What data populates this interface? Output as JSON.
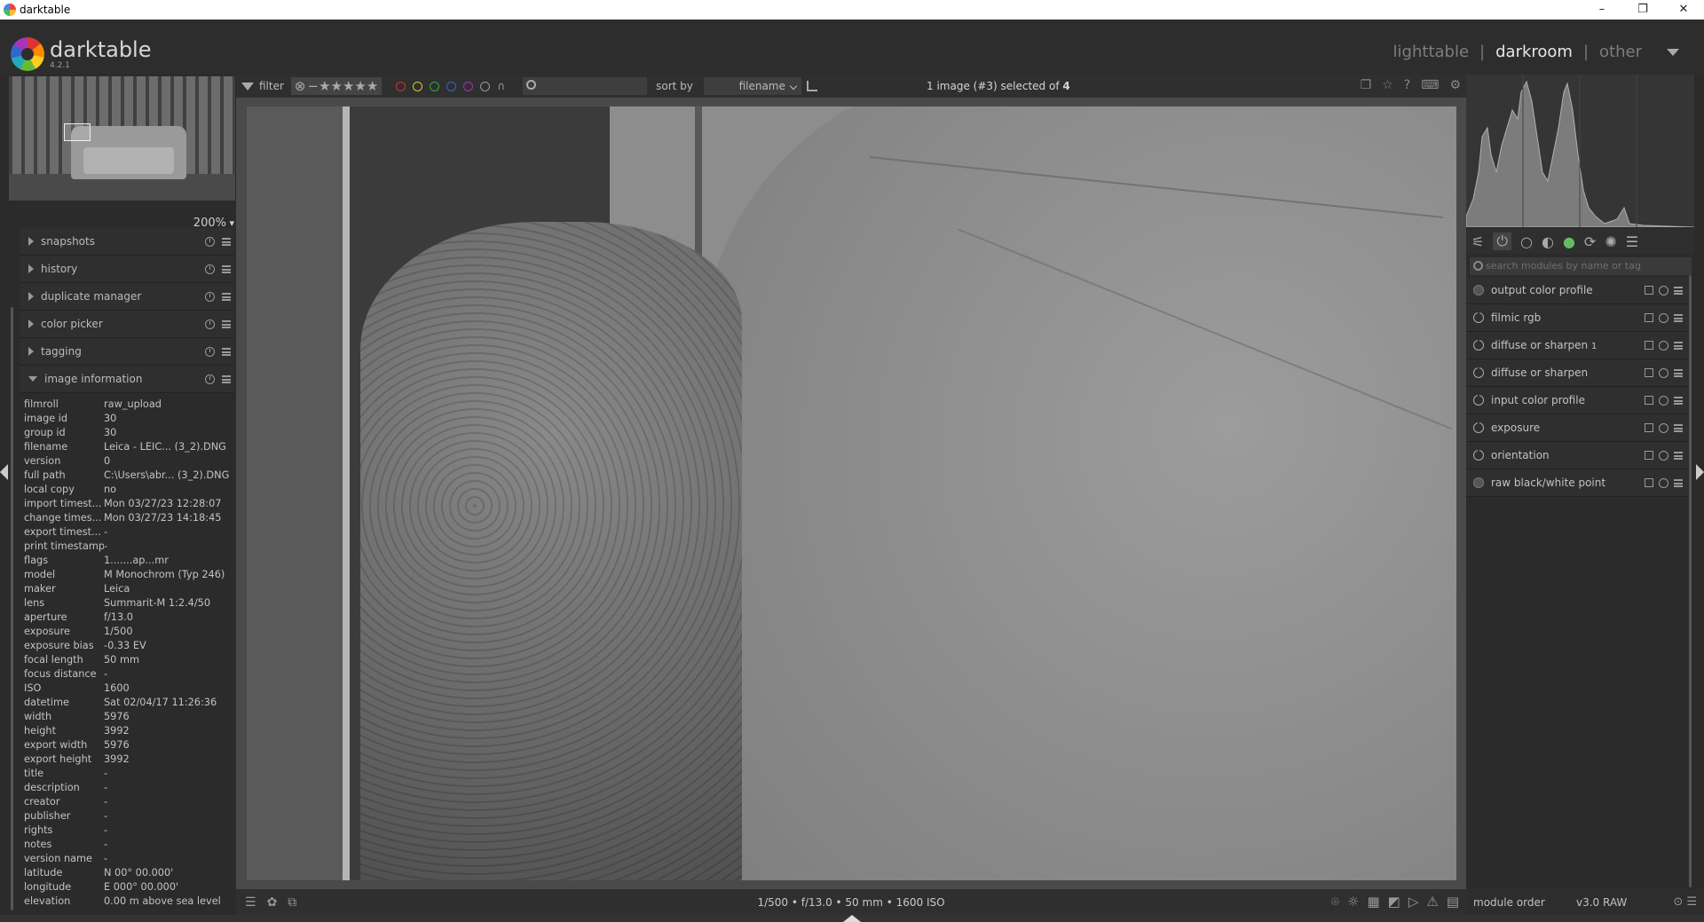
{
  "window": {
    "title": "darktable",
    "controls": [
      "–",
      "❐",
      "✕"
    ]
  },
  "header": {
    "brand": "darktable",
    "version": "4.2.1",
    "views": [
      "lighttable",
      "darkroom",
      "other"
    ],
    "active_view": "darkroom"
  },
  "navigation": {
    "zoom": "200%"
  },
  "left_modules": [
    {
      "label": "snapshots",
      "expanded": false
    },
    {
      "label": "history",
      "expanded": false
    },
    {
      "label": "duplicate manager",
      "expanded": false
    },
    {
      "label": "color picker",
      "expanded": false
    },
    {
      "label": "tagging",
      "expanded": false
    },
    {
      "label": "image information",
      "expanded": true
    }
  ],
  "image_info": [
    {
      "k": "filmroll",
      "v": "raw_upload"
    },
    {
      "k": "image id",
      "v": "30"
    },
    {
      "k": "group id",
      "v": "30"
    },
    {
      "k": "filename",
      "v": "Leica - LEIC...  (3_2).DNG"
    },
    {
      "k": "version",
      "v": "0"
    },
    {
      "k": "full path",
      "v": "C:\\Users\\abr...  (3_2).DNG"
    },
    {
      "k": "local copy",
      "v": "no"
    },
    {
      "k": "import timest...",
      "v": "Mon 03/27/23 12:28:07"
    },
    {
      "k": "change times...",
      "v": "Mon 03/27/23 14:18:45"
    },
    {
      "k": "export timest...",
      "v": "-"
    },
    {
      "k": "print timestamp",
      "v": "-"
    },
    {
      "k": "flags",
      "v": "1.......ap...mr"
    },
    {
      "k": "model",
      "v": "M Monochrom (Typ 246)"
    },
    {
      "k": "maker",
      "v": "Leica"
    },
    {
      "k": "lens",
      "v": "Summarit-M 1:2.4/50"
    },
    {
      "k": "aperture",
      "v": "f/13.0"
    },
    {
      "k": "exposure",
      "v": "1/500"
    },
    {
      "k": "exposure bias",
      "v": "-0.33 EV"
    },
    {
      "k": "focal length",
      "v": "50 mm"
    },
    {
      "k": "focus distance",
      "v": "-"
    },
    {
      "k": "ISO",
      "v": "1600"
    },
    {
      "k": "datetime",
      "v": "Sat 02/04/17 11:26:36"
    },
    {
      "k": "width",
      "v": "5976"
    },
    {
      "k": "height",
      "v": "3992"
    },
    {
      "k": "export width",
      "v": "5976"
    },
    {
      "k": "export height",
      "v": "3992"
    },
    {
      "k": "title",
      "v": "-"
    },
    {
      "k": "description",
      "v": "-"
    },
    {
      "k": "creator",
      "v": "-"
    },
    {
      "k": "publisher",
      "v": "-"
    },
    {
      "k": "rights",
      "v": "-"
    },
    {
      "k": "notes",
      "v": "-"
    },
    {
      "k": "version name",
      "v": "-"
    },
    {
      "k": "latitude",
      "v": "N 00° 00.000'"
    },
    {
      "k": "longitude",
      "v": "E 000° 00.000'"
    },
    {
      "k": "elevation",
      "v": "0.00 m above sea level"
    }
  ],
  "filterbar": {
    "filter_label": "filter",
    "sort_label": "sort by",
    "sort_value": "filename",
    "search_value": "",
    "count_pre": "1 image (#3) selected of ",
    "count_total": "4"
  },
  "bottombar": {
    "exif": "1/500 • f/13.0 • 50 mm • 1600 ISO"
  },
  "right": {
    "search_placeholder": "search modules by name or tag",
    "modules": [
      {
        "label": "output color profile",
        "always_on": true
      },
      {
        "label": "filmic rgb",
        "always_on": false
      },
      {
        "label": "diffuse or sharpen",
        "suffix": "1",
        "always_on": false
      },
      {
        "label": "diffuse or sharpen",
        "always_on": false
      },
      {
        "label": "input color profile",
        "always_on": false
      },
      {
        "label": "exposure",
        "always_on": false
      },
      {
        "label": "orientation",
        "always_on": false
      },
      {
        "label": "raw black/white point",
        "always_on": true
      }
    ],
    "module_order_label": "module order",
    "module_order_value": "v3.0 RAW"
  }
}
